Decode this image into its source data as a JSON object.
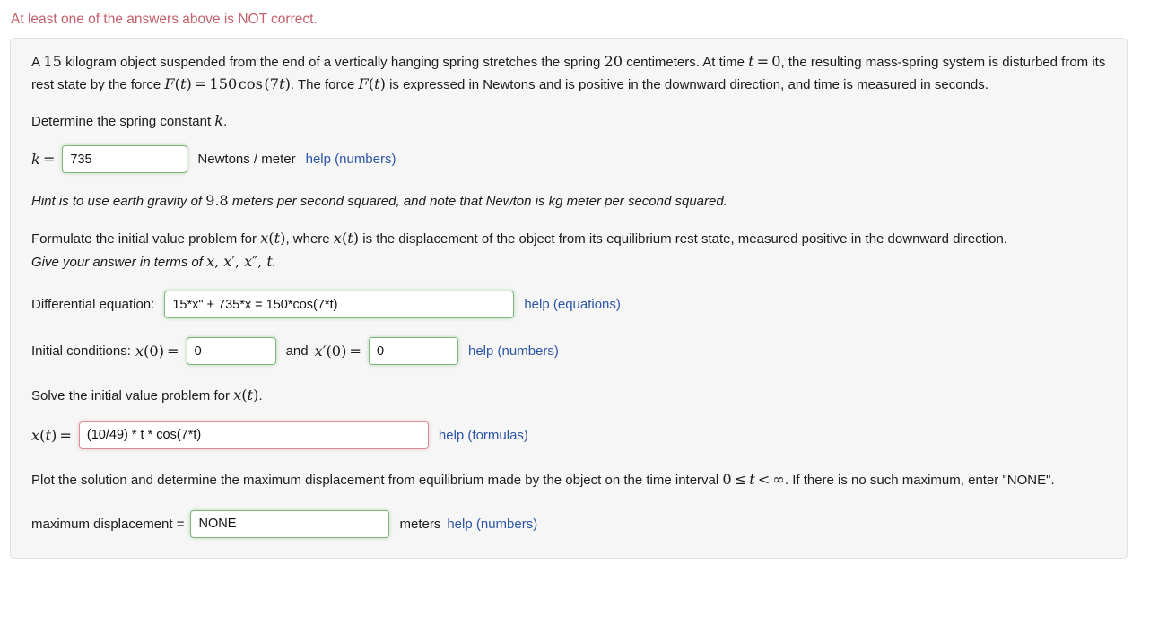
{
  "alert": {
    "text": "At least one of the answers above is NOT correct.",
    "color": "#c4606c"
  },
  "problem": {
    "intro": {
      "seg1": "A ",
      "mass": "15",
      "seg2": " kilogram object suspended from the end of a vertically hanging spring stretches the spring ",
      "stretch": "20",
      "seg3": " centimeters. At time ",
      "time_var": "t",
      "eq": "=",
      "time_val": "0",
      "seg4": ", the resulting mass-spring system is disturbed from its rest state by the force ",
      "force_F": "F",
      "force_open": "(",
      "force_t": "t",
      "force_close": ")",
      "force_eq": "=",
      "force_amp": "150",
      "force_cos": "cos",
      "force_arg_open": "(",
      "force_arg_num": "7",
      "force_arg_var": "t",
      "force_arg_close": ")",
      "seg5": ". The force ",
      "seg6": " is expressed in Newtons and is positive in the downward direction, and time is measured in seconds."
    },
    "determine_k": {
      "text_before": "Determine the spring constant ",
      "symbol": "k",
      "text_after": "."
    },
    "k_row": {
      "label_k": "k",
      "label_eq": "=",
      "value": "735",
      "unit": "Newtons / meter",
      "help": "help (numbers)",
      "state": "correct"
    },
    "hint": {
      "seg1": "Hint is to use earth gravity of ",
      "gravity": "9.8",
      "seg2": " meters per second squared, and note that Newton is kg meter per second squared."
    },
    "formulate": {
      "seg1": "Formulate the initial value problem for ",
      "x": "x",
      "open": "(",
      "t": "t",
      "close": ")",
      "seg2": ", where ",
      "seg3": " is the displacement of the object from its equilibrium rest state, measured positive in the downward direction."
    },
    "give_answer": {
      "seg1": "Give your answer in terms of ",
      "v1": "x",
      "c1": ", ",
      "v2": "x",
      "p2": "′",
      "c2": ", ",
      "v3": "x",
      "p3": "″",
      "c3": ", ",
      "v4": "t",
      "period": "."
    },
    "diff_eq_row": {
      "label": "Differential equation:",
      "value": "15*x\" + 735*x = 150*cos(7*t)",
      "help": "help (equations)",
      "state": "correct"
    },
    "initial_conditions_row": {
      "label": "Initial conditions:",
      "x_sym": "x",
      "x_open": "(",
      "x_zero": "0",
      "x_close": ")",
      "x_eq": "=",
      "x0_value": "0",
      "and": "and",
      "xp_sym": "x",
      "xp_prime": "′",
      "xp_open": "(",
      "xp_zero": "0",
      "xp_close": ")",
      "xp_eq": "=",
      "xp0_value": "0",
      "help": "help (numbers)",
      "state_x0": "correct",
      "state_xp0": "correct"
    },
    "solve_ivp": {
      "seg1": "Solve the initial value problem for ",
      "x": "x",
      "open": "(",
      "t": "t",
      "close": ")",
      "seg2": "."
    },
    "solution_row": {
      "label_x": "x",
      "label_open": "(",
      "label_t": "t",
      "label_close": ")",
      "label_eq": "=",
      "value": "(10/49) * t * cos(7*t)",
      "help": "help (formulas)",
      "state": "incorrect"
    },
    "plot_para": {
      "seg1": "Plot the solution and determine the maximum displacement from equilibrium made by the object on the time interval ",
      "zero": "0",
      "le": "≤",
      "t": "t",
      "lt": "<",
      "inf": "∞",
      "seg2": ". If there is no such maximum, enter \"NONE\"."
    },
    "max_disp_row": {
      "label": "maximum displacement =",
      "value": "NONE",
      "unit": "meters",
      "help": "help (numbers)",
      "state": "correct"
    }
  },
  "colors": {
    "panel_bg": "#f6f6f6",
    "panel_border": "#e0e0e0",
    "link": "#2c55a5",
    "correct_border": "#7bb87b",
    "incorrect_border": "#d98f96",
    "text": "#1b1b1b"
  }
}
